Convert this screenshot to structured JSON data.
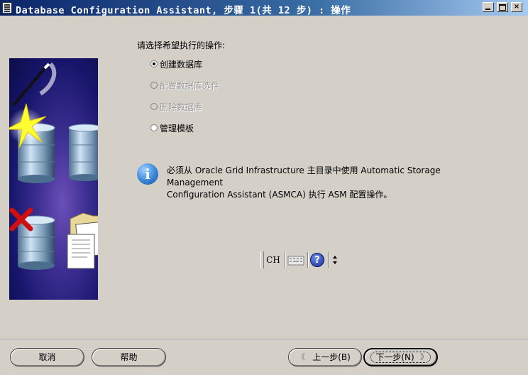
{
  "window": {
    "title": "Database Configuration Assistant, 步骤 1(共 12 步) : 操作",
    "controls": {
      "minimize": "_",
      "maximize": "□",
      "close": "×"
    }
  },
  "main": {
    "prompt": "请选择希望执行的操作:",
    "options": [
      {
        "label": "创建数据库",
        "selected": true,
        "enabled": true
      },
      {
        "label": "配置数据库选件",
        "selected": false,
        "enabled": false
      },
      {
        "label": "删除数据库",
        "selected": false,
        "enabled": false
      },
      {
        "label": "管理模板",
        "selected": false,
        "enabled": true
      }
    ],
    "info": {
      "icon": "info-icon",
      "line1": "必须从 Oracle Grid Infrastructure 主目录中使用 Automatic Storage Management",
      "line2": "Configuration Assistant (ASMCA) 执行 ASM 配置操作。"
    }
  },
  "ime_toolbar": {
    "mode": "CH",
    "help": "?"
  },
  "buttons": {
    "cancel": "取消",
    "help": "帮助",
    "back": "上一步(B)",
    "next": "下一步(N)"
  },
  "colors": {
    "title_start": "#0a246a",
    "title_end": "#a6caf0",
    "dialog_bg": "#d4d0c8",
    "art_bg": "#16156a"
  }
}
